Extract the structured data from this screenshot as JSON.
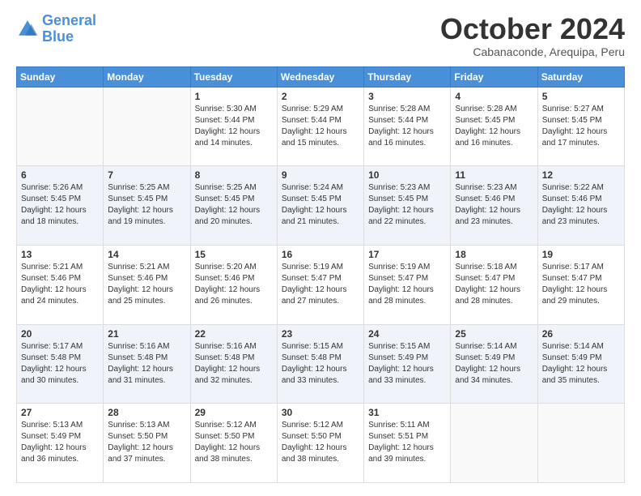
{
  "logo": {
    "line1": "General",
    "line2": "Blue"
  },
  "title": "October 2024",
  "subtitle": "Cabanaconde, Arequipa, Peru",
  "days_of_week": [
    "Sunday",
    "Monday",
    "Tuesday",
    "Wednesday",
    "Thursday",
    "Friday",
    "Saturday"
  ],
  "weeks": [
    [
      {
        "day": "",
        "sunrise": "",
        "sunset": "",
        "daylight": ""
      },
      {
        "day": "",
        "sunrise": "",
        "sunset": "",
        "daylight": ""
      },
      {
        "day": "1",
        "sunrise": "Sunrise: 5:30 AM",
        "sunset": "Sunset: 5:44 PM",
        "daylight": "Daylight: 12 hours and 14 minutes."
      },
      {
        "day": "2",
        "sunrise": "Sunrise: 5:29 AM",
        "sunset": "Sunset: 5:44 PM",
        "daylight": "Daylight: 12 hours and 15 minutes."
      },
      {
        "day": "3",
        "sunrise": "Sunrise: 5:28 AM",
        "sunset": "Sunset: 5:44 PM",
        "daylight": "Daylight: 12 hours and 16 minutes."
      },
      {
        "day": "4",
        "sunrise": "Sunrise: 5:28 AM",
        "sunset": "Sunset: 5:45 PM",
        "daylight": "Daylight: 12 hours and 16 minutes."
      },
      {
        "day": "5",
        "sunrise": "Sunrise: 5:27 AM",
        "sunset": "Sunset: 5:45 PM",
        "daylight": "Daylight: 12 hours and 17 minutes."
      }
    ],
    [
      {
        "day": "6",
        "sunrise": "Sunrise: 5:26 AM",
        "sunset": "Sunset: 5:45 PM",
        "daylight": "Daylight: 12 hours and 18 minutes."
      },
      {
        "day": "7",
        "sunrise": "Sunrise: 5:25 AM",
        "sunset": "Sunset: 5:45 PM",
        "daylight": "Daylight: 12 hours and 19 minutes."
      },
      {
        "day": "8",
        "sunrise": "Sunrise: 5:25 AM",
        "sunset": "Sunset: 5:45 PM",
        "daylight": "Daylight: 12 hours and 20 minutes."
      },
      {
        "day": "9",
        "sunrise": "Sunrise: 5:24 AM",
        "sunset": "Sunset: 5:45 PM",
        "daylight": "Daylight: 12 hours and 21 minutes."
      },
      {
        "day": "10",
        "sunrise": "Sunrise: 5:23 AM",
        "sunset": "Sunset: 5:45 PM",
        "daylight": "Daylight: 12 hours and 22 minutes."
      },
      {
        "day": "11",
        "sunrise": "Sunrise: 5:23 AM",
        "sunset": "Sunset: 5:46 PM",
        "daylight": "Daylight: 12 hours and 23 minutes."
      },
      {
        "day": "12",
        "sunrise": "Sunrise: 5:22 AM",
        "sunset": "Sunset: 5:46 PM",
        "daylight": "Daylight: 12 hours and 23 minutes."
      }
    ],
    [
      {
        "day": "13",
        "sunrise": "Sunrise: 5:21 AM",
        "sunset": "Sunset: 5:46 PM",
        "daylight": "Daylight: 12 hours and 24 minutes."
      },
      {
        "day": "14",
        "sunrise": "Sunrise: 5:21 AM",
        "sunset": "Sunset: 5:46 PM",
        "daylight": "Daylight: 12 hours and 25 minutes."
      },
      {
        "day": "15",
        "sunrise": "Sunrise: 5:20 AM",
        "sunset": "Sunset: 5:46 PM",
        "daylight": "Daylight: 12 hours and 26 minutes."
      },
      {
        "day": "16",
        "sunrise": "Sunrise: 5:19 AM",
        "sunset": "Sunset: 5:47 PM",
        "daylight": "Daylight: 12 hours and 27 minutes."
      },
      {
        "day": "17",
        "sunrise": "Sunrise: 5:19 AM",
        "sunset": "Sunset: 5:47 PM",
        "daylight": "Daylight: 12 hours and 28 minutes."
      },
      {
        "day": "18",
        "sunrise": "Sunrise: 5:18 AM",
        "sunset": "Sunset: 5:47 PM",
        "daylight": "Daylight: 12 hours and 28 minutes."
      },
      {
        "day": "19",
        "sunrise": "Sunrise: 5:17 AM",
        "sunset": "Sunset: 5:47 PM",
        "daylight": "Daylight: 12 hours and 29 minutes."
      }
    ],
    [
      {
        "day": "20",
        "sunrise": "Sunrise: 5:17 AM",
        "sunset": "Sunset: 5:48 PM",
        "daylight": "Daylight: 12 hours and 30 minutes."
      },
      {
        "day": "21",
        "sunrise": "Sunrise: 5:16 AM",
        "sunset": "Sunset: 5:48 PM",
        "daylight": "Daylight: 12 hours and 31 minutes."
      },
      {
        "day": "22",
        "sunrise": "Sunrise: 5:16 AM",
        "sunset": "Sunset: 5:48 PM",
        "daylight": "Daylight: 12 hours and 32 minutes."
      },
      {
        "day": "23",
        "sunrise": "Sunrise: 5:15 AM",
        "sunset": "Sunset: 5:48 PM",
        "daylight": "Daylight: 12 hours and 33 minutes."
      },
      {
        "day": "24",
        "sunrise": "Sunrise: 5:15 AM",
        "sunset": "Sunset: 5:49 PM",
        "daylight": "Daylight: 12 hours and 33 minutes."
      },
      {
        "day": "25",
        "sunrise": "Sunrise: 5:14 AM",
        "sunset": "Sunset: 5:49 PM",
        "daylight": "Daylight: 12 hours and 34 minutes."
      },
      {
        "day": "26",
        "sunrise": "Sunrise: 5:14 AM",
        "sunset": "Sunset: 5:49 PM",
        "daylight": "Daylight: 12 hours and 35 minutes."
      }
    ],
    [
      {
        "day": "27",
        "sunrise": "Sunrise: 5:13 AM",
        "sunset": "Sunset: 5:49 PM",
        "daylight": "Daylight: 12 hours and 36 minutes."
      },
      {
        "day": "28",
        "sunrise": "Sunrise: 5:13 AM",
        "sunset": "Sunset: 5:50 PM",
        "daylight": "Daylight: 12 hours and 37 minutes."
      },
      {
        "day": "29",
        "sunrise": "Sunrise: 5:12 AM",
        "sunset": "Sunset: 5:50 PM",
        "daylight": "Daylight: 12 hours and 38 minutes."
      },
      {
        "day": "30",
        "sunrise": "Sunrise: 5:12 AM",
        "sunset": "Sunset: 5:50 PM",
        "daylight": "Daylight: 12 hours and 38 minutes."
      },
      {
        "day": "31",
        "sunrise": "Sunrise: 5:11 AM",
        "sunset": "Sunset: 5:51 PM",
        "daylight": "Daylight: 12 hours and 39 minutes."
      },
      {
        "day": "",
        "sunrise": "",
        "sunset": "",
        "daylight": ""
      },
      {
        "day": "",
        "sunrise": "",
        "sunset": "",
        "daylight": ""
      }
    ]
  ]
}
